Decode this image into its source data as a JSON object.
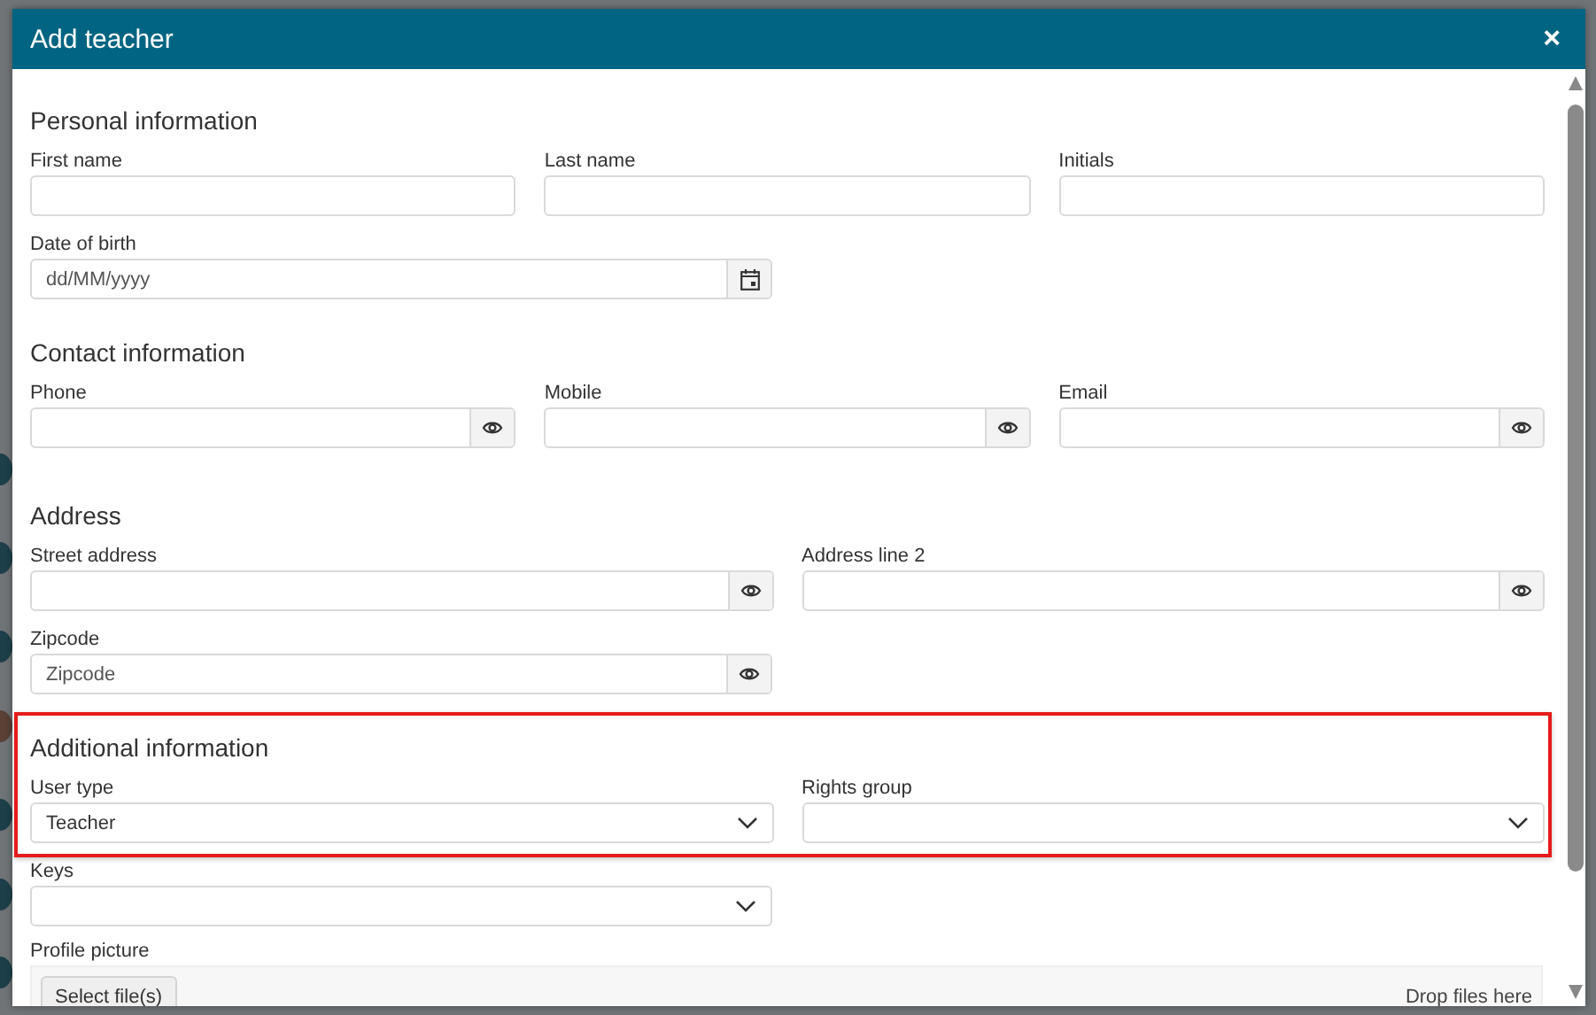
{
  "dialog": {
    "title": "Add teacher",
    "close": "×"
  },
  "sections": [
    {
      "heading": "Personal information",
      "highlighted": false,
      "rows": [
        [
          {
            "kind": "text",
            "label": "First name"
          },
          {
            "kind": "text",
            "label": "Last name"
          },
          {
            "kind": "text",
            "label": "Initials"
          }
        ],
        [
          {
            "kind": "date",
            "label": "Date of birth",
            "placeholder": "dd/MM/yyyy"
          }
        ]
      ]
    },
    {
      "heading": "Contact information",
      "highlighted": false,
      "rows": [
        [
          {
            "kind": "eye",
            "label": "Phone"
          },
          {
            "kind": "eye",
            "label": "Mobile"
          },
          {
            "kind": "eye",
            "label": "Email"
          }
        ]
      ]
    },
    {
      "heading": "Address",
      "highlighted": false,
      "rows": [
        [
          {
            "kind": "eye",
            "label": "Street address"
          },
          {
            "kind": "eye",
            "label": "Address line 2"
          }
        ],
        [
          {
            "kind": "eye",
            "label": "Zipcode",
            "placeholder": "Zipcode"
          }
        ]
      ]
    },
    {
      "heading": "Additional information",
      "highlighted": true,
      "rows": [
        [
          {
            "kind": "select",
            "label": "User type",
            "value": "Teacher"
          },
          {
            "kind": "select",
            "label": "Rights group"
          }
        ],
        [
          {
            "kind": "select",
            "label": "Keys"
          }
        ],
        [
          {
            "kind": "file",
            "label": "Profile picture",
            "button": "Select file(s)",
            "hint": "Drop files here"
          }
        ]
      ]
    }
  ]
}
